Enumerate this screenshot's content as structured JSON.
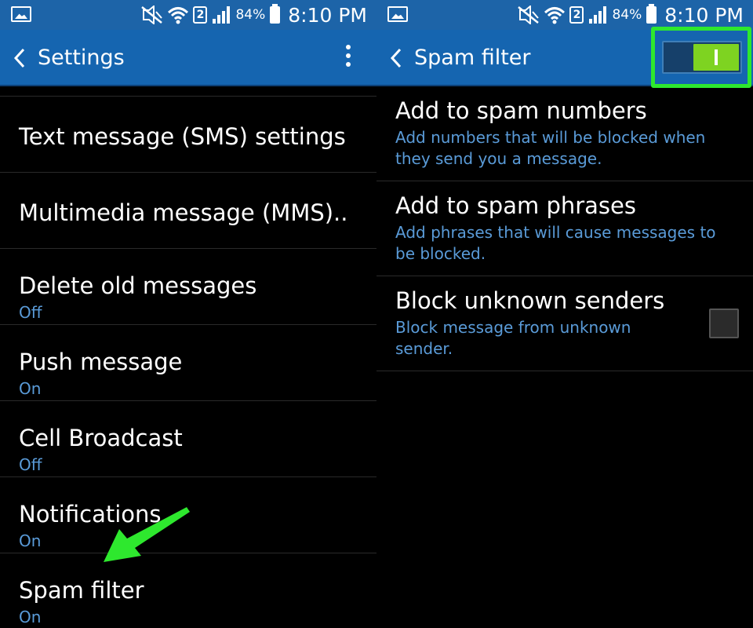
{
  "status_bar": {
    "battery_percent": "84%",
    "sim_label": "2",
    "time": "8:10 PM"
  },
  "left_screen": {
    "title": "Settings",
    "items": [
      {
        "title": "Text message (SMS) settings",
        "subtitle": ""
      },
      {
        "title": "Multimedia message (MMS)..",
        "subtitle": ""
      },
      {
        "title": "Delete old messages",
        "subtitle": "Off"
      },
      {
        "title": "Push message",
        "subtitle": "On"
      },
      {
        "title": "Cell Broadcast",
        "subtitle": "Off"
      },
      {
        "title": "Notifications",
        "subtitle": "On"
      },
      {
        "title": "Spam filter",
        "subtitle": "On"
      }
    ]
  },
  "right_screen": {
    "title": "Spam filter",
    "toggle_on": true,
    "items": [
      {
        "title": "Add to spam numbers",
        "subtitle": "Add numbers that will be blocked when they send you a message."
      },
      {
        "title": "Add to spam phrases",
        "subtitle": "Add phrases that will cause messages to be blocked."
      },
      {
        "title": "Block unknown senders",
        "subtitle": "Block message from unknown sender.",
        "checked": false
      }
    ]
  },
  "colors": {
    "status_bar": "#1d64a8",
    "action_bar": "#1565b0",
    "subtitle_text": "#5a9bd8",
    "toggle_on": "#7ed321",
    "highlight": "#2ee82e"
  },
  "icons": [
    "gallery-icon",
    "mute-icon",
    "wifi-icon",
    "signal-icon",
    "battery-icon",
    "back-icon",
    "overflow-menu-icon",
    "annotation-arrow-icon"
  ]
}
